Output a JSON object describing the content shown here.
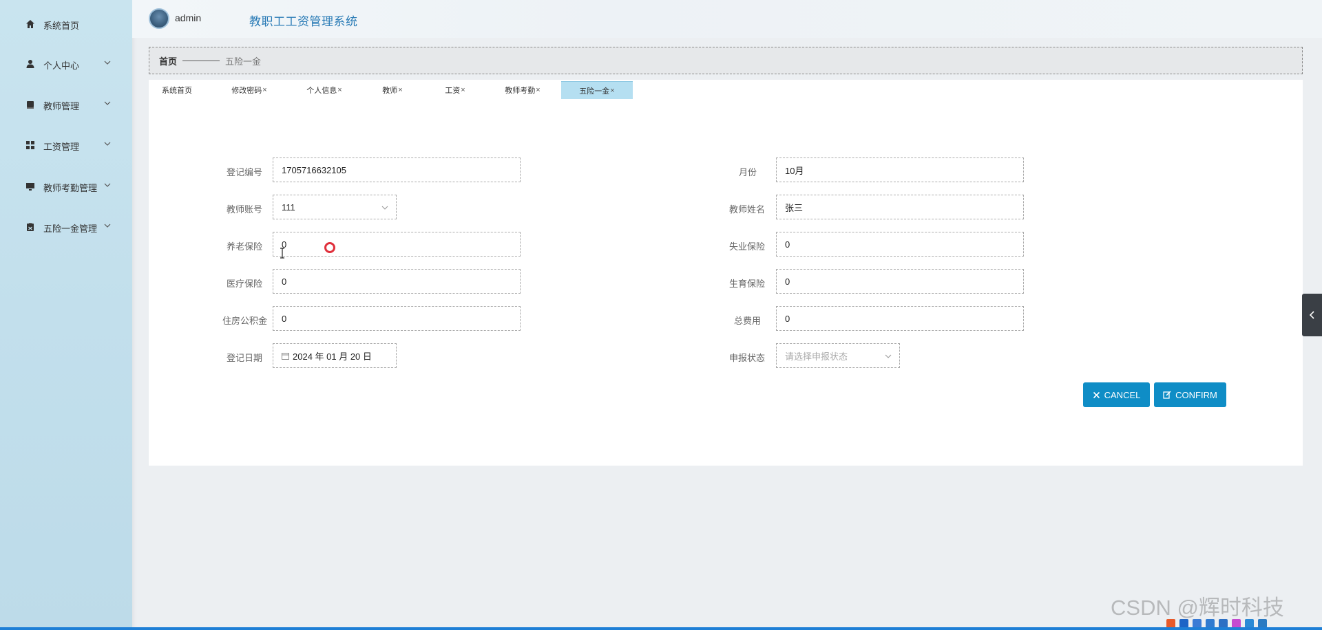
{
  "header": {
    "username": "admin",
    "system_title": "教职工工资管理系统"
  },
  "sidebar": {
    "items": [
      {
        "label": "系统首页",
        "icon": "home-icon",
        "has_chevron": false
      },
      {
        "label": "个人中心",
        "icon": "user-icon",
        "has_chevron": true
      },
      {
        "label": "教师管理",
        "icon": "book-icon",
        "has_chevron": true
      },
      {
        "label": "工资管理",
        "icon": "grid-icon",
        "has_chevron": true
      },
      {
        "label": "教师考勤管理",
        "icon": "monitor-icon",
        "has_chevron": true
      },
      {
        "label": "五险一金管理",
        "icon": "clipboard-icon",
        "has_chevron": true
      }
    ]
  },
  "breadcrumb": {
    "home": "首页",
    "current": "五险一金"
  },
  "tabs": [
    {
      "label": "系统首页",
      "closable": false,
      "active": false
    },
    {
      "label": "修改密码",
      "closable": true,
      "active": false
    },
    {
      "label": "个人信息",
      "closable": true,
      "active": false
    },
    {
      "label": "教师",
      "closable": true,
      "active": false
    },
    {
      "label": "工资",
      "closable": true,
      "active": false
    },
    {
      "label": "教师考勤",
      "closable": true,
      "active": false
    },
    {
      "label": "五险一金",
      "closable": true,
      "active": true
    }
  ],
  "tab_close_glyph": "×",
  "form": {
    "reg_no": {
      "label": "登记编号",
      "value": "1705716632105"
    },
    "month": {
      "label": "月份",
      "value": "10月"
    },
    "teacher_account": {
      "label": "教师账号",
      "value": "111"
    },
    "teacher_name": {
      "label": "教师姓名",
      "value": "张三"
    },
    "pension": {
      "label": "养老保险",
      "value": "0"
    },
    "unemployment": {
      "label": "失业保险",
      "value": "0"
    },
    "medical": {
      "label": "医疗保险",
      "value": "0"
    },
    "maternity": {
      "label": "生育保险",
      "value": "0"
    },
    "housing_fund": {
      "label": "住房公积金",
      "value": "0"
    },
    "total": {
      "label": "总费用",
      "value": "0"
    },
    "reg_date": {
      "label": "登记日期",
      "value": "2024 年 01 月 20 日"
    },
    "status": {
      "label": "申报状态",
      "placeholder": "请选择申报状态"
    }
  },
  "buttons": {
    "cancel": "CANCEL",
    "confirm": "CONFIRM"
  },
  "watermark": "CSDN @辉时科技",
  "colors": {
    "primary": "#0f8dc6",
    "title": "#2a7bb6",
    "active_tab": "#b5dff1",
    "sidebar": "#c4e0ec"
  }
}
